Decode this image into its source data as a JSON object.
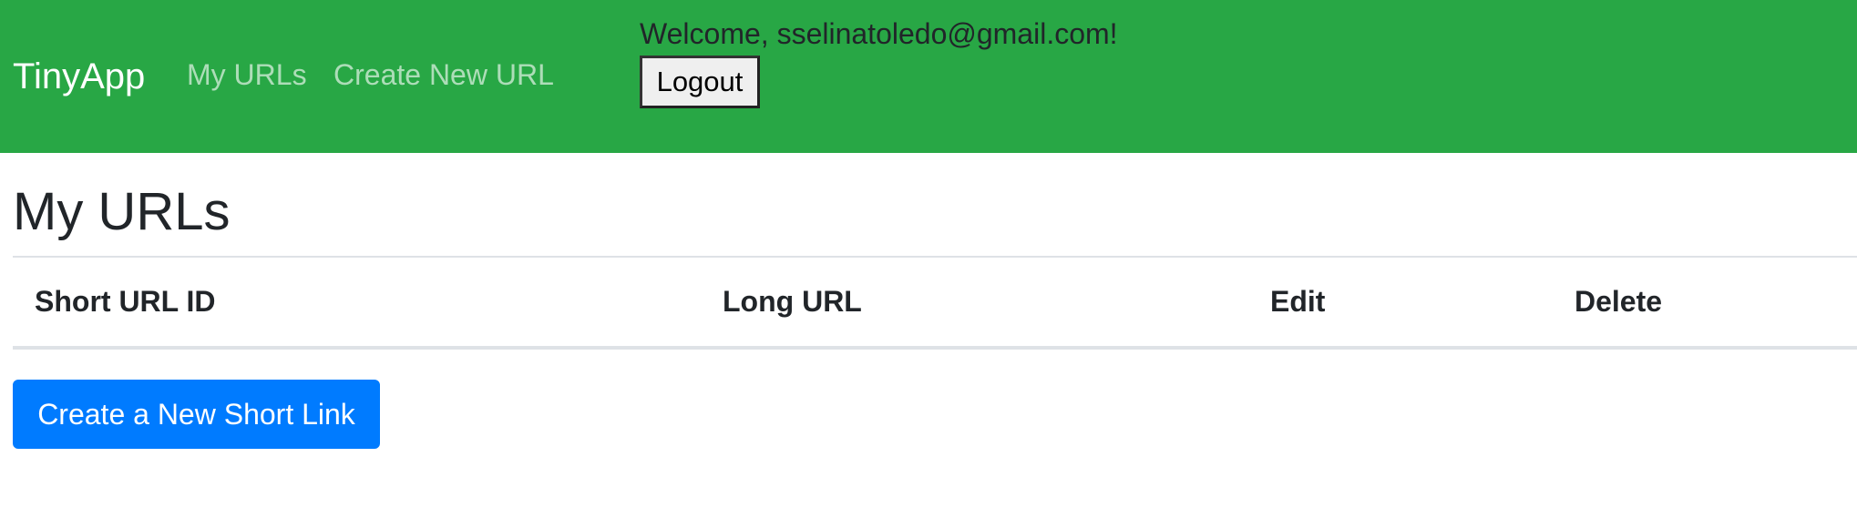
{
  "navbar": {
    "brand": "TinyApp",
    "links": [
      {
        "label": "My URLs"
      },
      {
        "label": "Create New URL"
      }
    ],
    "welcome_text": "Welcome, sselinatoledo@gmail.com!",
    "logout_label": "Logout",
    "background_color": "#28a745"
  },
  "main": {
    "title": "My URLs",
    "table": {
      "headers": [
        "Short URL ID",
        "Long URL",
        "Edit",
        "Delete"
      ],
      "rows": []
    },
    "create_button_label": "Create a New Short Link",
    "create_button_color": "#007bff"
  }
}
